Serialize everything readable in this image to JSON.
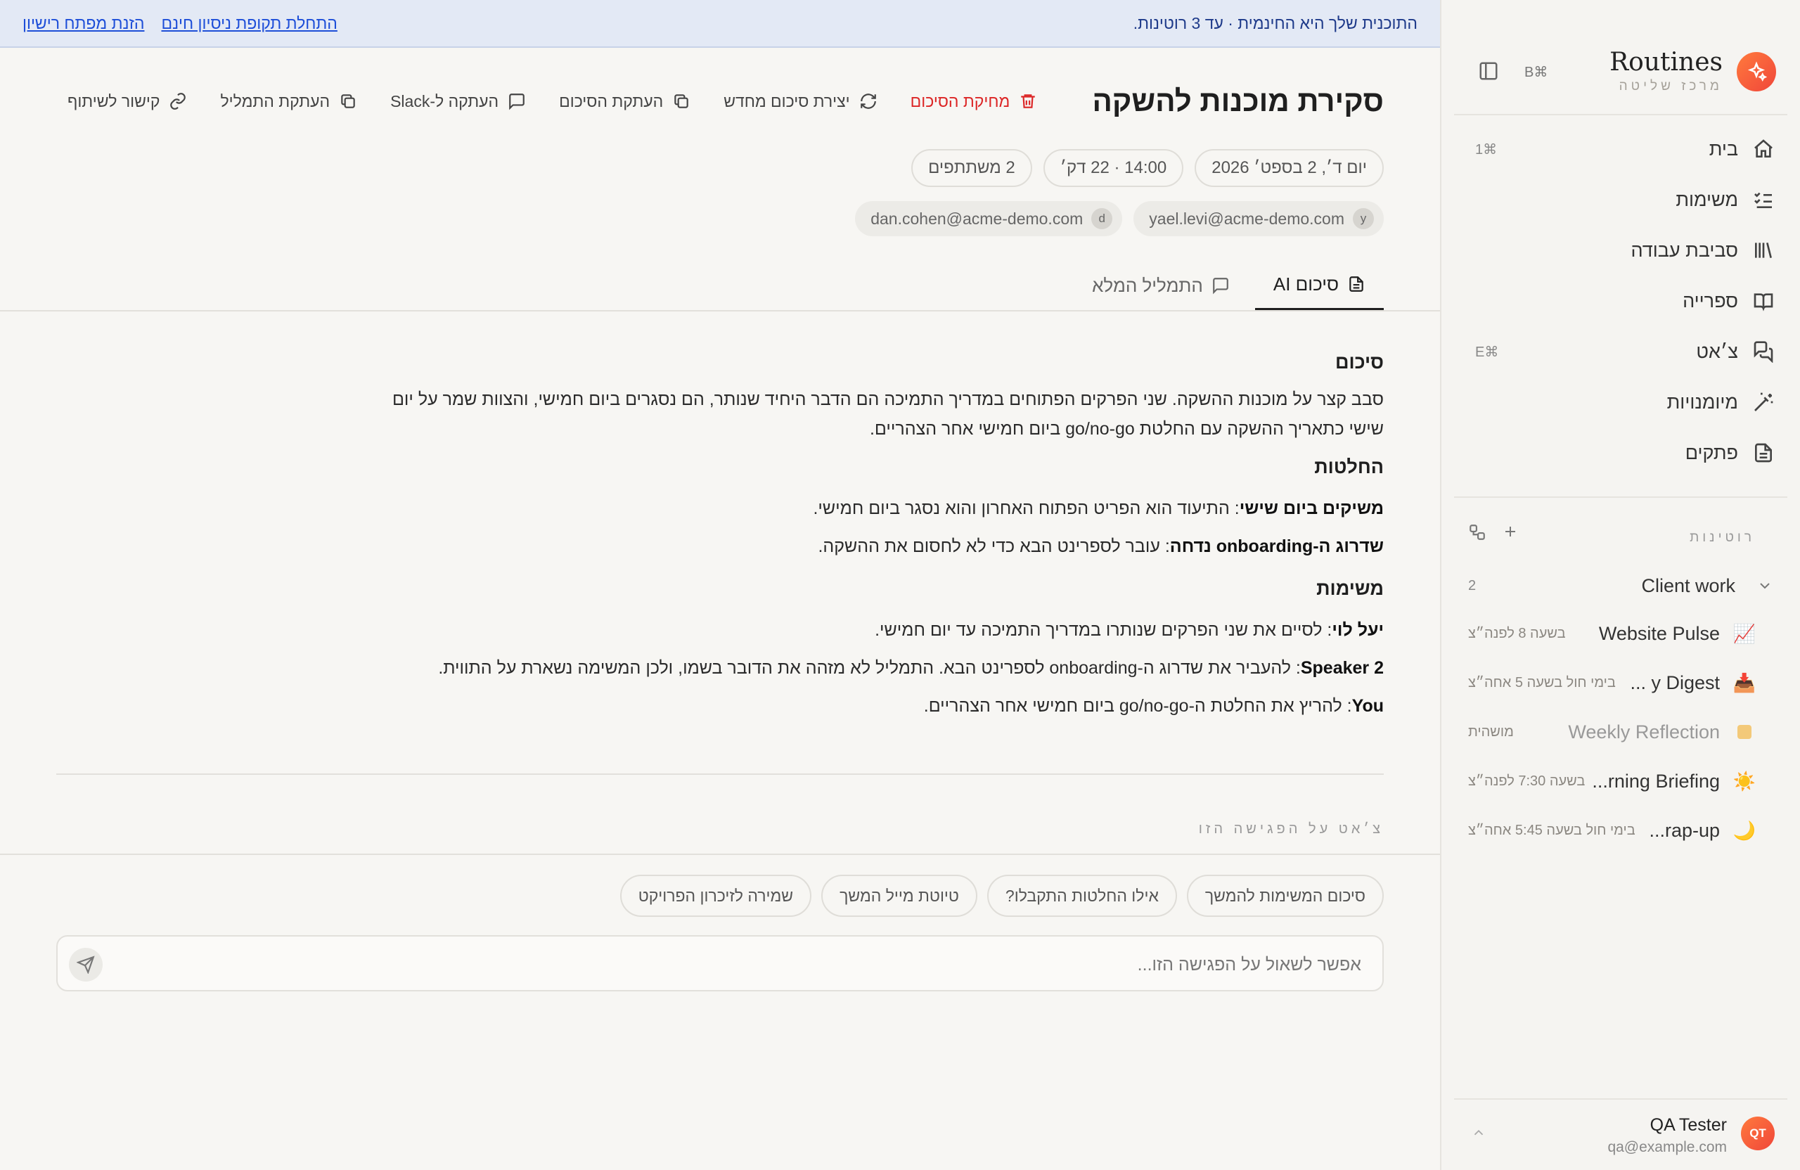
{
  "banner": {
    "message": "התוכנית שלך היא החינמית · עד 3 רוטינות.",
    "trial_link": "התחלת תקופת ניסיון חינם",
    "license_link": "הזנת מפתח רישיון"
  },
  "brand": {
    "title": "Routines",
    "subtitle": "מרכז שליטה",
    "shortcut": "⌘B"
  },
  "nav": [
    {
      "label": "בית",
      "shortcut": "⌘1",
      "icon": "home-icon"
    },
    {
      "label": "משימות",
      "shortcut": "",
      "icon": "checklist-icon"
    },
    {
      "label": "סביבת עבודה",
      "shortcut": "",
      "icon": "library-icon"
    },
    {
      "label": "ספרייה",
      "shortcut": "",
      "icon": "book-icon"
    },
    {
      "label": "צ׳אט",
      "shortcut": "⌘E",
      "icon": "chat-icon"
    },
    {
      "label": "מיומנויות",
      "shortcut": "",
      "icon": "wand-icon"
    },
    {
      "label": "פתקים",
      "shortcut": "",
      "icon": "note-icon"
    }
  ],
  "routines_section": {
    "label": "רוטינות",
    "group": {
      "label": "Client work",
      "count": "2"
    },
    "items": [
      {
        "emoji": "📈",
        "name": "Website Pulse",
        "schedule": "בשעה 8 לפנה״צ",
        "dim": false
      },
      {
        "emoji": "📥",
        "name": "y Digest ...",
        "schedule": "בימי חול בשעה 5 אחה״צ",
        "dim": false
      },
      {
        "emoji": "",
        "name": "Weekly Reflection",
        "schedule": "מושהית",
        "dim": true
      },
      {
        "emoji": "☀️",
        "name": "rning Briefing...",
        "schedule": "בשעה 7:30 לפנה״צ",
        "dim": false
      },
      {
        "emoji": "🌙",
        "name": "rap-up...",
        "schedule": "בימי חול בשעה 5:45 אחה״צ",
        "dim": false
      }
    ]
  },
  "user": {
    "initials": "QT",
    "name": "QA Tester",
    "email": "qa@example.com"
  },
  "meeting": {
    "title": "סקירת מוכנות להשקה",
    "actions": {
      "delete": "מחיקת הסיכום",
      "regenerate": "יצירת סיכום מחדש",
      "copy_summary": "העתקת הסיכום",
      "copy_slack": "העתקה ל-Slack",
      "copy_transcript": "העתקת התמליל",
      "share_link": "קישור לשיתוף"
    },
    "date": "יום ד׳, 2 בספט׳ 2026",
    "time": "14:00 · 22 דק׳",
    "participants_count": "2 משתתפים",
    "participants": [
      {
        "initial": "y",
        "email": "yael.levi@acme-demo.com"
      },
      {
        "initial": "d",
        "email": "dan.cohen@acme-demo.com"
      }
    ],
    "tabs": {
      "summary": "סיכום AI",
      "transcript": "התמליל המלא"
    }
  },
  "summary": {
    "summary_heading": "סיכום",
    "summary_text": "סבב קצר על מוכנות ההשקה. שני הפרקים הפתוחים במדריך התמיכה הם הדבר היחיד שנותר, הם נסגרים ביום חמישי, והצוות שמר על יום שישי כתאריך ההשקה עם החלטת go/no-go ביום חמישי אחר הצהריים.",
    "decisions_heading": "החלטות",
    "decisions": [
      {
        "bold": "משיקים ביום שישי",
        "text": ": התיעוד הוא הפריט הפתוח האחרון והוא נסגר ביום חמישי."
      },
      {
        "bold": "שדרוג ה-onboarding נדחה",
        "text": ": עובר לספרינט הבא כדי לא לחסום את ההשקה."
      }
    ],
    "tasks_heading": "משימות",
    "tasks": [
      {
        "bold": "יעל לוי",
        "text": ": לסיים את שני הפרקים שנותרו במדריך התמיכה עד יום חמישי."
      },
      {
        "bold": "Speaker 2",
        "text": ": להעביר את שדרוג ה-onboarding לספרינט הבא. התמליל לא מזהה את הדובר בשמו, ולכן המשימה נשארת על התווית."
      },
      {
        "bold": "You",
        "text": ": להריץ את החלטת ה-go/no-go ביום חמישי אחר הצהריים."
      }
    ]
  },
  "chat": {
    "label": "צ׳אט על הפגישה הזו",
    "suggestions": [
      "סיכום המשימות להמשך",
      "אילו החלטות התקבלו?",
      "טיוטת מייל המשך",
      "שמירה לזיכרון הפרויקט"
    ],
    "placeholder": "אפשר לשאול על הפגישה הזו...",
    "value": ""
  },
  "colors": {
    "accent": "#f0463a",
    "danger": "#dc2626",
    "link": "#1d4ed8",
    "banner_bg": "#e3e9f5"
  }
}
